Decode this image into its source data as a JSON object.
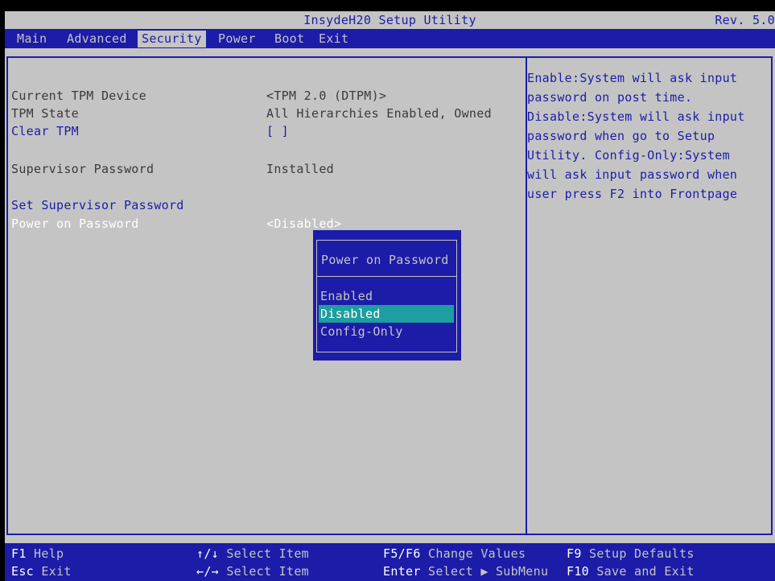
{
  "title": "InsydeH20 Setup Utility",
  "revision": "Rev. 5.0",
  "menu": [
    "Main",
    "Advanced",
    "Security",
    "Power",
    "Boot",
    "Exit"
  ],
  "active_menu": "Security",
  "settings": [
    {
      "label": "Current TPM Device",
      "value": "<TPM 2.0 (DTPM)>"
    },
    {
      "label": "TPM State",
      "value": "All Hierarchies Enabled, Owned"
    },
    {
      "label": "Clear TPM",
      "value": "[ ]"
    },
    {
      "label": "Supervisor Password",
      "value": "Installed"
    },
    {
      "label": "Set Supervisor Password",
      "value": ""
    },
    {
      "label": "Power on Password",
      "value": "<Disabled>"
    }
  ],
  "help_lines": [
    "Enable:System will ask input",
    "password on post time.",
    "Disable:System will ask input",
    "password when go to Setup",
    "Utility. Config-Only:System",
    "will ask input password when",
    "user press F2 into Frontpage"
  ],
  "popup": {
    "title": "Power on Password",
    "options": [
      "Enabled",
      "Disabled",
      "Config-Only"
    ],
    "selected": "Disabled"
  },
  "footer": {
    "f1": {
      "key": "F1",
      "desc": "Help"
    },
    "esc": {
      "key": "Esc",
      "desc": "Exit"
    },
    "updown": {
      "key": "↑/↓",
      "desc": "Select Item"
    },
    "leftright": {
      "key": "←/→",
      "desc": "Select Item"
    },
    "f5f6": {
      "key": "F5/F6",
      "desc": "Change Values"
    },
    "enter": {
      "key": "Enter",
      "desc": "Select ▶ SubMenu"
    },
    "f9": {
      "key": "F9",
      "desc": "Setup Defaults"
    },
    "f10": {
      "key": "F10",
      "desc": "Save and Exit"
    }
  },
  "colors": {
    "blue": "#1c1ca8",
    "grey": "#c4c4c4",
    "highlight": "#1e9e9e"
  }
}
